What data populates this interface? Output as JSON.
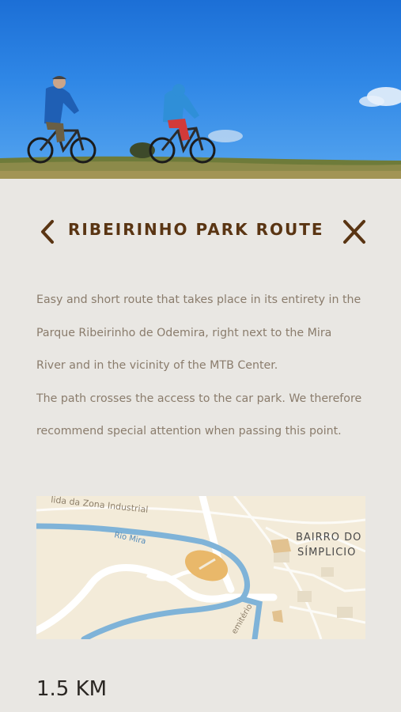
{
  "header": {
    "title": "RIBEIRINHO PARK ROUTE",
    "back_icon": "chevron-left-icon",
    "close_icon": "close-icon",
    "color": "#5a3513"
  },
  "hero": {
    "image": "photo-two-cyclists-on-grassy-hill"
  },
  "description": {
    "lines": [
      "Easy and short route that takes place in its entirety in the",
      "Parque Ribeirinho de Odemira, right next to the Mira",
      "River and in the vicinity of the MTB Center.",
      "The path crosses the access to the car park. We therefore",
      "recommend special attention when passing this point."
    ]
  },
  "map": {
    "labels": {
      "road_top": "lida da Zona Industrial",
      "river": "Rio Mira",
      "district_line1": "BAIRRO DO",
      "district_line2": "SÍMPLICIO",
      "road_bottom": "emitério"
    },
    "colors": {
      "land": "#f3ebd9",
      "water": "#7fb3d8",
      "route": "#e9b86a",
      "road": "#ffffff"
    }
  },
  "stats": {
    "distance": "1.5 KM"
  }
}
